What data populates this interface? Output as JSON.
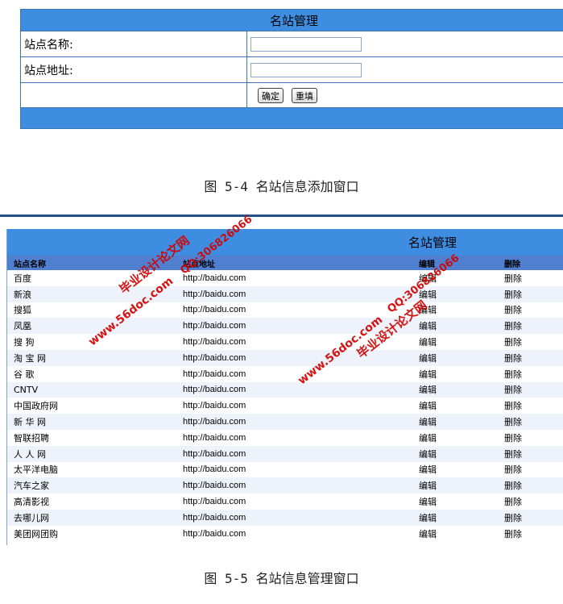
{
  "form": {
    "title": "名站管理",
    "name_label": "站点名称:",
    "name_value": "",
    "url_label": "站点地址:",
    "url_value": "",
    "confirm_label": "确定",
    "reset_label": "重填"
  },
  "caption_form": "图 5-4 名站信息添加窗口",
  "table": {
    "title": "名站管理",
    "headers": {
      "name": "站点名称",
      "url": "站点地址",
      "edit": "编辑",
      "delete": "删除"
    },
    "rows": [
      {
        "name": "百度",
        "url": "http://baidu.com",
        "edit": "编辑",
        "del": "删除"
      },
      {
        "name": "新浪",
        "url": "http://baidu.com",
        "edit": "编辑",
        "del": "删除"
      },
      {
        "name": "搜狐",
        "url": "http://baidu.com",
        "edit": "编辑",
        "del": "删除"
      },
      {
        "name": "凤凰",
        "url": "http://baidu.com",
        "edit": "编辑",
        "del": "删除"
      },
      {
        "name": "搜  狗",
        "url": "http://baidu.com",
        "edit": "编辑",
        "del": "删除"
      },
      {
        "name": "淘 宝 网",
        "url": "http://baidu.com",
        "edit": "编辑",
        "del": "删除"
      },
      {
        "name": "谷  歌",
        "url": "http://baidu.com",
        "edit": "编辑",
        "del": "删除"
      },
      {
        "name": "CNTV",
        "url": "http://baidu.com",
        "edit": "编辑",
        "del": "删除"
      },
      {
        "name": "中国政府网",
        "url": "http://baidu.com",
        "edit": "编辑",
        "del": "删除"
      },
      {
        "name": "新 华 网",
        "url": "http://baidu.com",
        "edit": "编辑",
        "del": "删除"
      },
      {
        "name": "智联招聘",
        "url": "http://baidu.com",
        "edit": "编辑",
        "del": "删除"
      },
      {
        "name": "人 人 网",
        "url": "http://baidu.com",
        "edit": "编辑",
        "del": "删除"
      },
      {
        "name": "太平洋电脑",
        "url": "http://baidu.com",
        "edit": "编辑",
        "del": "删除"
      },
      {
        "name": "汽车之家",
        "url": "http://baidu.com",
        "edit": "编辑",
        "del": "删除"
      },
      {
        "name": "高清影视",
        "url": "http://baidu.com",
        "edit": "编辑",
        "del": "删除"
      },
      {
        "name": "去哪儿网",
        "url": "http://baidu.com",
        "edit": "编辑",
        "del": "删除"
      },
      {
        "name": "美团网团购",
        "url": "http://baidu.com",
        "edit": "编辑",
        "del": "删除"
      }
    ]
  },
  "caption_table": "图 5-5 名站信息管理窗口",
  "watermarks": {
    "qq": "QQ:306826066",
    "site_name": "毕业设计论文网",
    "site_url": "www.56doc.com"
  }
}
